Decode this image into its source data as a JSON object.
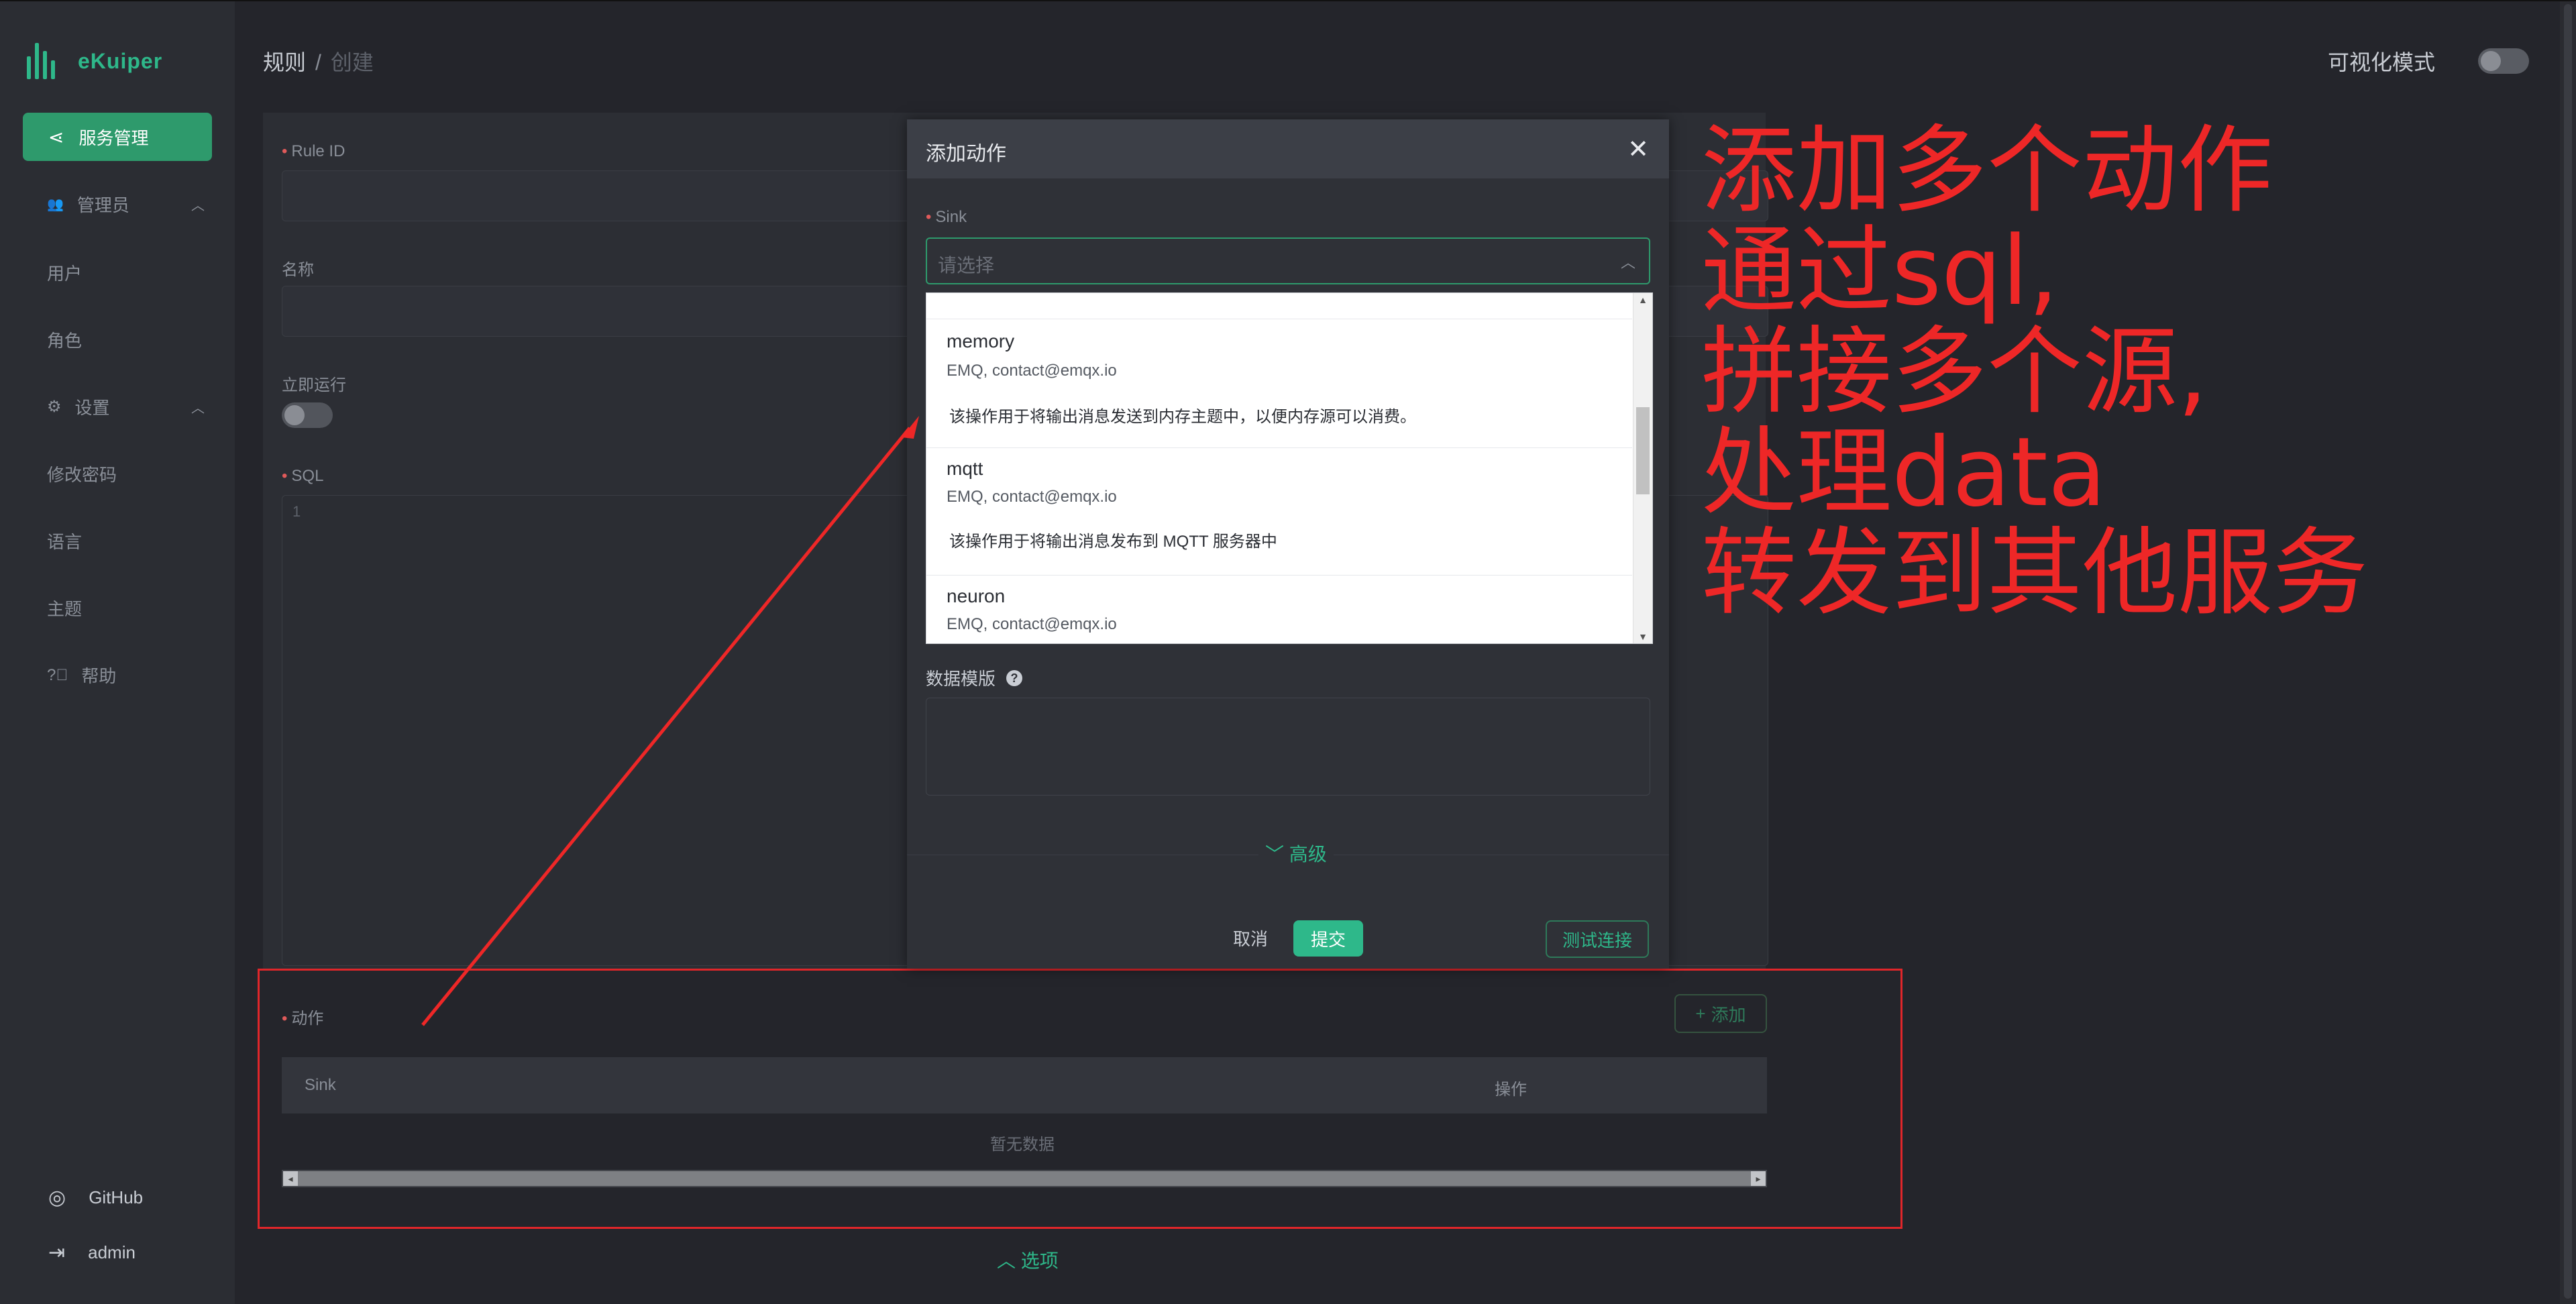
{
  "sidebar": {
    "logo_text": "eKuiper",
    "active_item": "服务管理",
    "items": [
      {
        "label": "管理员",
        "has_caret": true
      },
      {
        "label": "用户"
      },
      {
        "label": "角色"
      },
      {
        "label": "设置",
        "has_caret": true
      },
      {
        "label": "修改密码"
      },
      {
        "label": "语言"
      },
      {
        "label": "主题"
      },
      {
        "label": "帮助"
      }
    ],
    "footer": {
      "github": "GitHub",
      "user": "admin"
    }
  },
  "breadcrumb": {
    "parent": "规则",
    "separator": "/",
    "current": "创建"
  },
  "visual_mode_label": "可视化模式",
  "form": {
    "rule_id_label": "Rule ID",
    "name_label": "名称",
    "run_now_label": "立即运行",
    "sql_label": "SQL",
    "sql_line": "1",
    "actions_label": "动作",
    "add_button": "添加",
    "table": {
      "col_sink": "Sink",
      "col_ops": "操作",
      "empty": "暂无数据"
    },
    "options_label": "选项"
  },
  "modal": {
    "title": "添加动作",
    "sink_label": "Sink",
    "sink_placeholder": "请选择",
    "options": [
      {
        "name": "memory",
        "author": "EMQ, contact@emqx.io",
        "desc": "该操作用于将输出消息发送到内存主题中，以便内存源可以消费。"
      },
      {
        "name": "mqtt",
        "author": "EMQ, contact@emqx.io",
        "desc": "该操作用于将输出消息发布到 MQTT 服务器中"
      },
      {
        "name": "neuron",
        "author": "EMQ, contact@emqx.io",
        "desc": ""
      }
    ],
    "template_label": "数据模版",
    "advanced_label": "高级",
    "cancel": "取消",
    "submit": "提交",
    "test_connection": "测试连接"
  },
  "annotation": {
    "lines": [
      "添加多个动作",
      "通过sql,",
      "拼接多个源,",
      "处理data",
      "转发到其他服务"
    ]
  },
  "colors": {
    "accent": "#2eb88a",
    "annotation": "#ee2727",
    "background": "#24252b"
  }
}
